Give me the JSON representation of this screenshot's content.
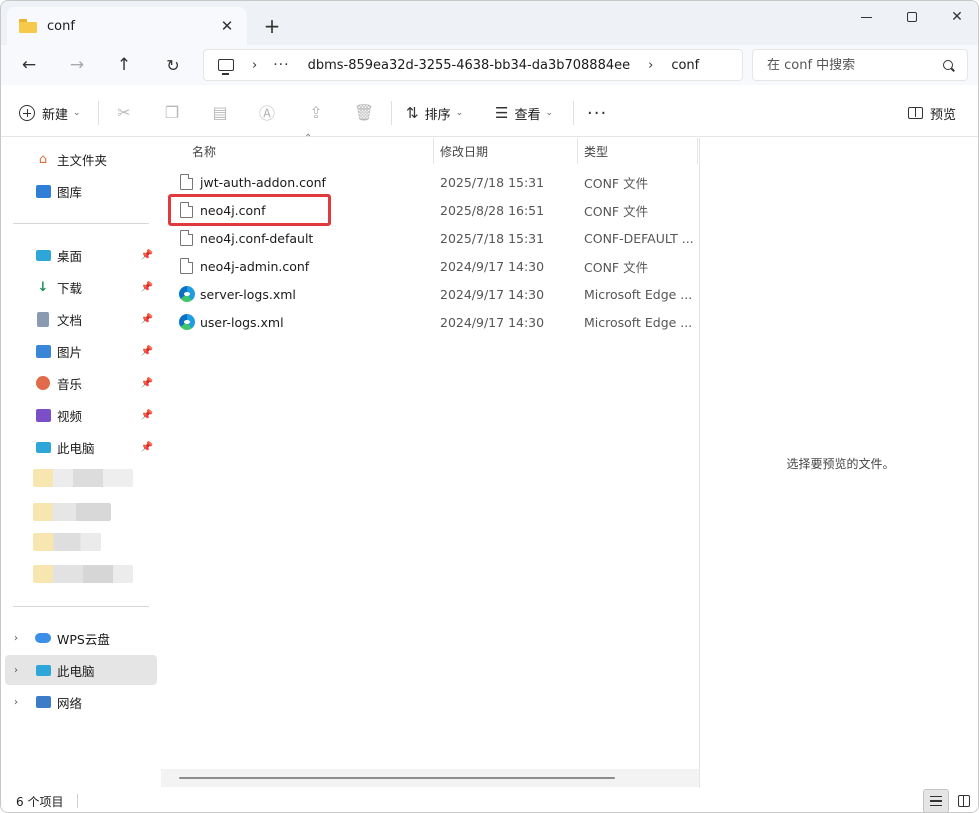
{
  "tab": {
    "title": "conf",
    "close": "✕",
    "new_tab": "+"
  },
  "window_controls": {
    "minimize": "minimize",
    "maximize": "maximize",
    "close": "✕"
  },
  "nav": {
    "back": "←",
    "forward": "→",
    "up": "↑",
    "refresh": "↻"
  },
  "address": {
    "more": "···",
    "separator": "›",
    "crumbs": [
      "dbms-859ea32d-3255-4638-bb34-da3b708884ee",
      "conf"
    ]
  },
  "search": {
    "placeholder": "在 conf 中搜索"
  },
  "toolbar": {
    "new_label": "新建",
    "sort_label": "排序",
    "view_label": "查看",
    "more": "···",
    "preview_label": "预览"
  },
  "sidebar": {
    "quick": [
      {
        "label": "主文件夹",
        "icon": "home-icon"
      },
      {
        "label": "图库",
        "icon": "gallery-icon"
      }
    ],
    "pinned": [
      {
        "label": "桌面",
        "icon": "desktop-icon"
      },
      {
        "label": "下载",
        "icon": "download-icon"
      },
      {
        "label": "文档",
        "icon": "documents-icon"
      },
      {
        "label": "图片",
        "icon": "pictures-icon"
      },
      {
        "label": "音乐",
        "icon": "music-icon"
      },
      {
        "label": "视频",
        "icon": "video-icon"
      },
      {
        "label": "此电脑",
        "icon": "pc-icon"
      }
    ],
    "tree": [
      {
        "label": "WPS云盘",
        "icon": "cloud-icon"
      },
      {
        "label": "此电脑",
        "icon": "pc-icon"
      },
      {
        "label": "网络",
        "icon": "network-icon"
      }
    ]
  },
  "columns": {
    "name": "名称",
    "date": "修改日期",
    "type": "类型"
  },
  "files": [
    {
      "name": "jwt-auth-addon.conf",
      "date": "2025/7/18 15:31",
      "type": "CONF 文件",
      "icon": "file-icon"
    },
    {
      "name": "neo4j.conf",
      "date": "2025/8/28 16:51",
      "type": "CONF 文件",
      "icon": "file-icon"
    },
    {
      "name": "neo4j.conf-default",
      "date": "2025/7/18 15:31",
      "type": "CONF-DEFAULT ...",
      "icon": "file-icon"
    },
    {
      "name": "neo4j-admin.conf",
      "date": "2024/9/17 14:30",
      "type": "CONF 文件",
      "icon": "file-icon"
    },
    {
      "name": "server-logs.xml",
      "date": "2024/9/17 14:30",
      "type": "Microsoft Edge ...",
      "icon": "edge-icon"
    },
    {
      "name": "user-logs.xml",
      "date": "2024/9/17 14:30",
      "type": "Microsoft Edge ...",
      "icon": "edge-icon"
    }
  ],
  "preview": {
    "empty_text": "选择要预览的文件。"
  },
  "status": {
    "count": "6 个项目"
  },
  "colors": {
    "highlight": "#e0393e",
    "selected_bg": "#e5e5e5",
    "folder": "#f6c94a"
  }
}
